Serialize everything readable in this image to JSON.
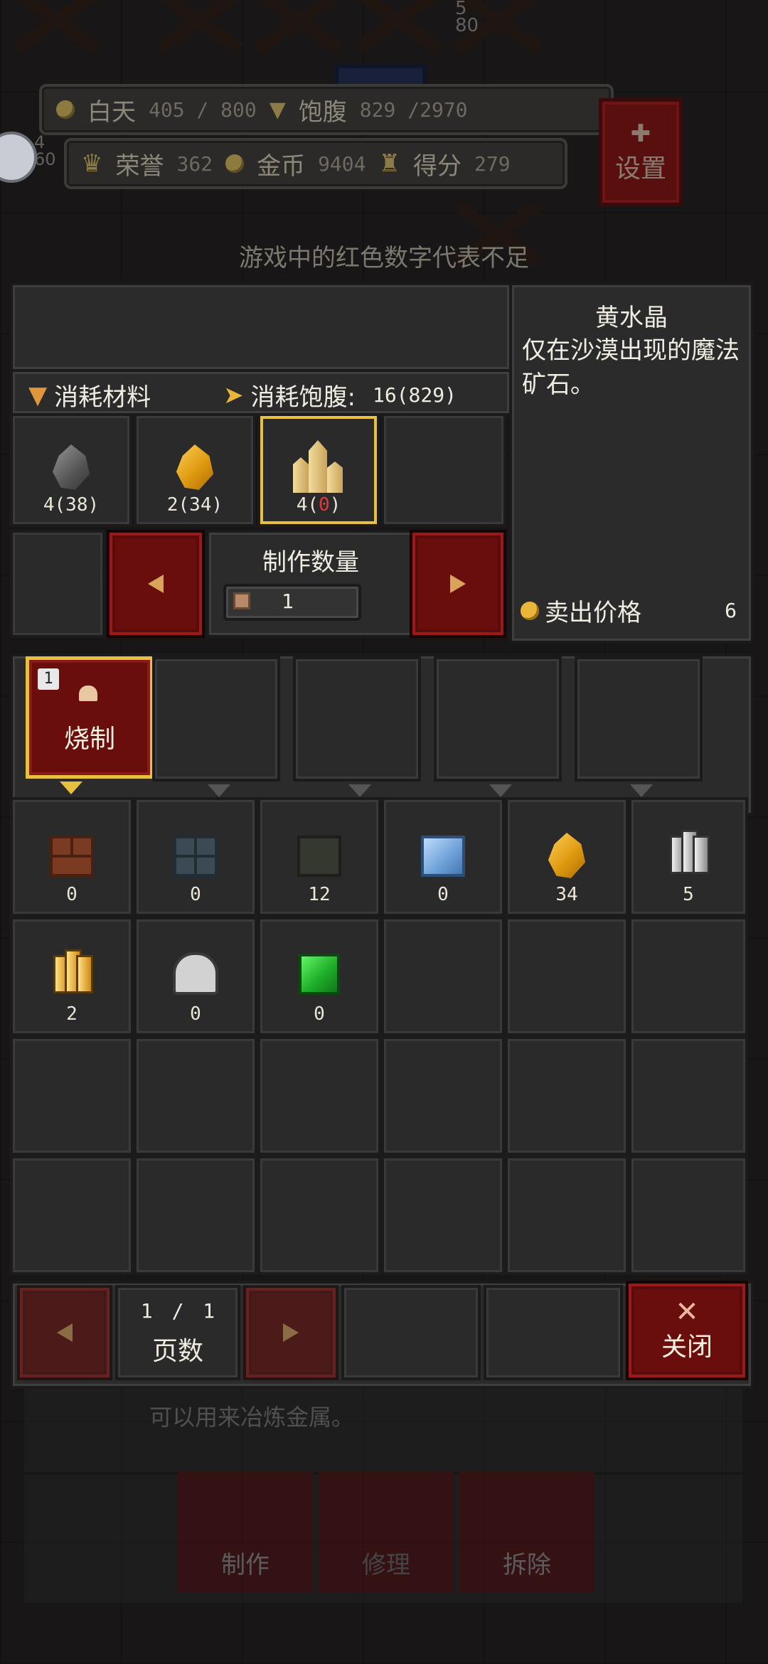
{
  "hud": {
    "day_label": "白天",
    "day_value": "405 / 800",
    "hunger_label": "饱腹",
    "hunger_value": "829 /2970",
    "honor_label": "荣誉",
    "honor_value": "362",
    "gold_label": "金币",
    "gold_value": "9404",
    "score_label": "得分",
    "score_value": "279",
    "settings_label": "设置",
    "bg_stat_a": "4",
    "bg_stat_b": "60",
    "bg_stat_c": "5",
    "bg_stat_d": "80"
  },
  "hint": "游戏中的红色数字代表不足",
  "detail": {
    "name": "黄水晶",
    "description": "仅在沙漠出现的魔法矿石。",
    "sell_label": "卖出价格",
    "sell_value": "6"
  },
  "cost": {
    "materials_label": "消耗材料",
    "hunger_label": "消耗饱腹:",
    "hunger_value": "16(829)"
  },
  "materials": [
    {
      "icon": "stone-ore-icon",
      "need": "4",
      "have": "(38)",
      "short": false
    },
    {
      "icon": "gold-gem-icon",
      "need": "2",
      "have": "(34)",
      "short": false
    },
    {
      "icon": "citrine-crystal-icon",
      "need": "4",
      "have_open": "(",
      "have_value": "0",
      "have_close": ")",
      "short": true
    }
  ],
  "quantity": {
    "label": "制作数量",
    "value": "1"
  },
  "categories": [
    {
      "label": "烧制",
      "badge": "1",
      "active": true
    },
    {
      "label": "",
      "active": false
    },
    {
      "label": "",
      "active": false
    },
    {
      "label": "",
      "active": false
    },
    {
      "label": "",
      "active": false
    }
  ],
  "inventory": [
    {
      "icon": "brick-icon",
      "count": "0"
    },
    {
      "icon": "stone-slab-icon",
      "count": "0"
    },
    {
      "icon": "dark-slab-icon",
      "count": "12"
    },
    {
      "icon": "glass-icon",
      "count": "0"
    },
    {
      "icon": "gold-gem-icon",
      "count": "34"
    },
    {
      "icon": "iron-ingot-icon",
      "count": "5"
    },
    {
      "icon": "gold-ingot-icon",
      "count": "2"
    },
    {
      "icon": "silver-ore-icon",
      "count": "0"
    },
    {
      "icon": "emerald-block-icon",
      "count": "0"
    }
  ],
  "pager": {
    "current": "1",
    "separator": "/",
    "total": "1",
    "label": "页数",
    "close_label": "关闭"
  },
  "background_panel": {
    "text": "可以用来冶炼金属。",
    "make_label": "制作",
    "repair_label": "修理",
    "dismantle_label": "拆除"
  },
  "colors": {
    "accent_red": "#6a0d0d",
    "selected_gold": "#e8c040",
    "shortage_red": "#e03a3a"
  }
}
